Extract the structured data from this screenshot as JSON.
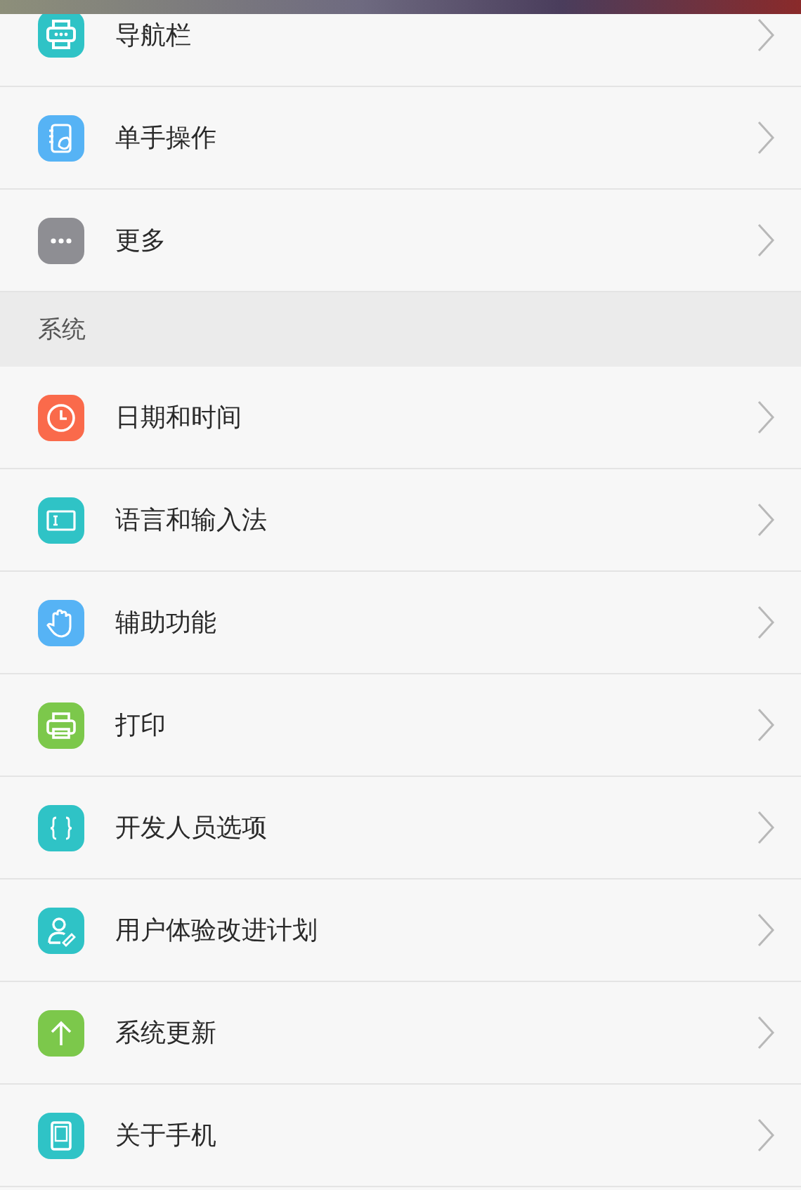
{
  "groups": [
    {
      "items": [
        {
          "label": "导航栏",
          "kind": "navbar",
          "color": "#2fc3c6"
        },
        {
          "label": "单手操作",
          "kind": "notebook",
          "color": "#56b3f5"
        },
        {
          "label": "更多",
          "kind": "dots",
          "color": "#8e8e93"
        }
      ]
    },
    {
      "title": "系统",
      "items": [
        {
          "label": "日期和时间",
          "kind": "clock",
          "color": "#fa6a4b"
        },
        {
          "label": "语言和输入法",
          "kind": "textbox",
          "color": "#2fc3c6"
        },
        {
          "label": "辅助功能",
          "kind": "hand",
          "color": "#56b3f5"
        },
        {
          "label": "打印",
          "kind": "printer",
          "color": "#7cc84b"
        },
        {
          "label": "开发人员选项",
          "kind": "braces",
          "color": "#2fc3c6"
        },
        {
          "label": "用户体验改进计划",
          "kind": "user",
          "color": "#2fc3c6"
        },
        {
          "label": "系统更新",
          "kind": "arrow",
          "color": "#7cc84b"
        },
        {
          "label": "关于手机",
          "kind": "phone",
          "color": "#2fc3c6"
        }
      ]
    }
  ]
}
